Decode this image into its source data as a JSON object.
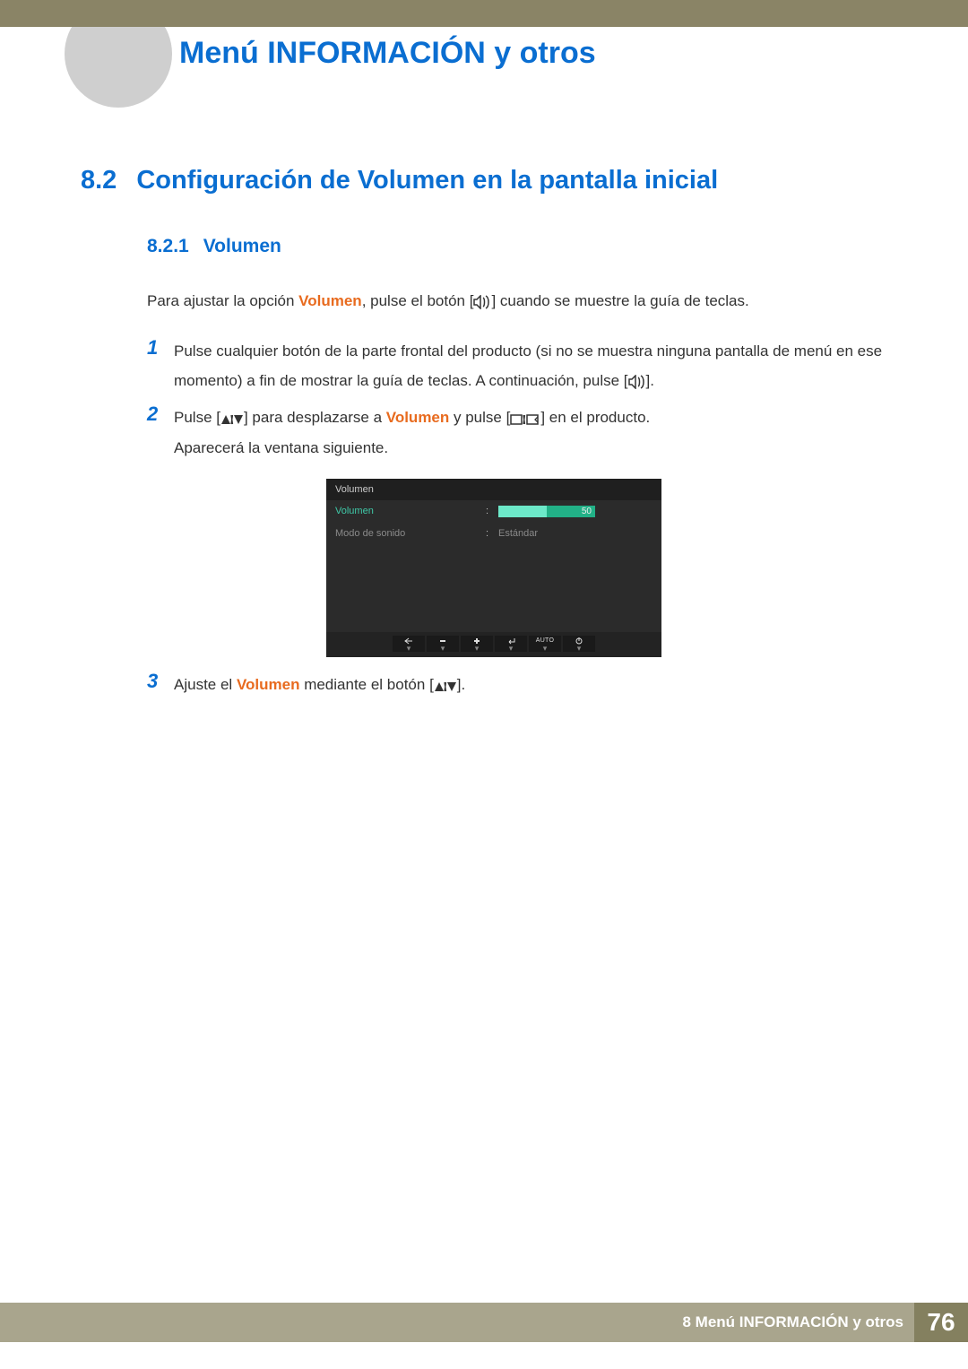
{
  "chapter_title": "Menú INFORMACIÓN y otros",
  "section": {
    "num": "8.2",
    "title": "Configuración de Volumen en la pantalla inicial"
  },
  "subsection": {
    "num": "8.2.1",
    "title": "Volumen"
  },
  "intro": {
    "pre": "Para ajustar la opción ",
    "strong": "Volumen",
    "post": ", pulse el botón [",
    "tail": "] cuando se muestre la guía de teclas."
  },
  "steps": [
    {
      "num": "1",
      "parts": [
        {
          "t": "Pulse cualquier botón de la parte frontal del producto (si no se muestra ninguna pantalla de menú en ese momento) a fin de mostrar la guía de teclas. A continuación, pulse ["
        },
        {
          "icon": "vol"
        },
        {
          "t": "]."
        }
      ]
    },
    {
      "num": "2",
      "parts": [
        {
          "t": "Pulse ["
        },
        {
          "icon": "ud"
        },
        {
          "t": "] para desplazarse a "
        },
        {
          "strong": "Volumen"
        },
        {
          "t": " y pulse ["
        },
        {
          "icon": "menu"
        },
        {
          "t": "] en el producto."
        }
      ],
      "after": "Aparecerá la ventana siguiente."
    },
    {
      "num": "3",
      "parts": [
        {
          "t": "Ajuste el "
        },
        {
          "strong": "Volumen"
        },
        {
          "t": " mediante el botón ["
        },
        {
          "icon": "ud"
        },
        {
          "t": "]."
        }
      ]
    }
  ],
  "osd": {
    "title": "Volumen",
    "rows": [
      {
        "label": "Volumen",
        "active": true,
        "value": "50"
      },
      {
        "label": "Modo de sonido",
        "active": false,
        "value": "Estándar"
      }
    ],
    "buttons": [
      "back",
      "minus",
      "plus",
      "enter",
      "AUTO",
      "power"
    ]
  },
  "footer": {
    "chapter_ref": "8 Menú INFORMACIÓN y otros",
    "page": "76"
  }
}
